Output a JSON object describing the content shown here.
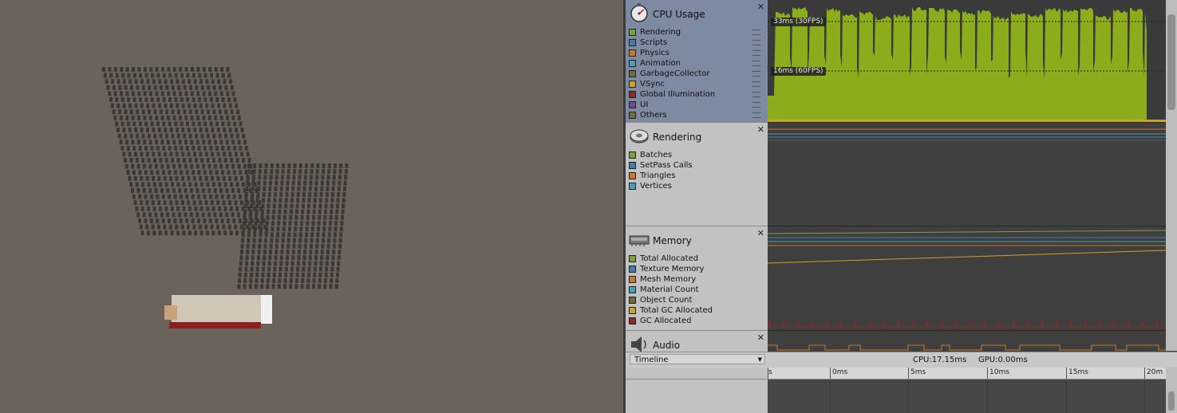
{
  "profiler": {
    "modules": [
      {
        "title": "CPU Usage",
        "icon": "stopwatch-icon",
        "items": [
          "Rendering",
          "Scripts",
          "Physics",
          "Animation",
          "GarbageCollector",
          "VSync",
          "Global Illumination",
          "UI",
          "Others"
        ],
        "colors": [
          "#7ea03a",
          "#3f7ea8",
          "#c8792a",
          "#4aa0b8",
          "#6b6b40",
          "#c8a42a",
          "#8a2a2a",
          "#6a4a8a",
          "#6b6b40"
        ],
        "fps_markers": [
          "33ms (30FPS)",
          "16ms (60FPS)"
        ]
      },
      {
        "title": "Rendering",
        "icon": "rendering-disc-icon",
        "items": [
          "Batches",
          "SetPass Calls",
          "Triangles",
          "Vertices"
        ],
        "colors": [
          "#7ea03a",
          "#3f7ea8",
          "#c8792a",
          "#4aa0b8"
        ]
      },
      {
        "title": "Memory",
        "icon": "memory-chip-icon",
        "items": [
          "Total Allocated",
          "Texture Memory",
          "Mesh Memory",
          "Material Count",
          "Object Count",
          "Total GC Allocated",
          "GC Allocated"
        ],
        "colors": [
          "#7ea03a",
          "#3f7ea8",
          "#c8792a",
          "#4aa0b8",
          "#6b6b40",
          "#c8a42a",
          "#8a2a2a"
        ]
      },
      {
        "title": "Audio",
        "icon": "speaker-icon",
        "items": [],
        "colors": []
      }
    ],
    "view_mode": "Timeline",
    "cpu_stat": "CPU:17.15ms",
    "gpu_stat": "GPU:0.00ms",
    "timeline_ticks": [
      "s",
      "0ms",
      "5ms",
      "10ms",
      "15ms",
      "20m"
    ],
    "accent_colors": {
      "cpu_fill": "#8bad1c",
      "vsync": "#c8a42a",
      "gc": "#8a2a2a"
    }
  }
}
